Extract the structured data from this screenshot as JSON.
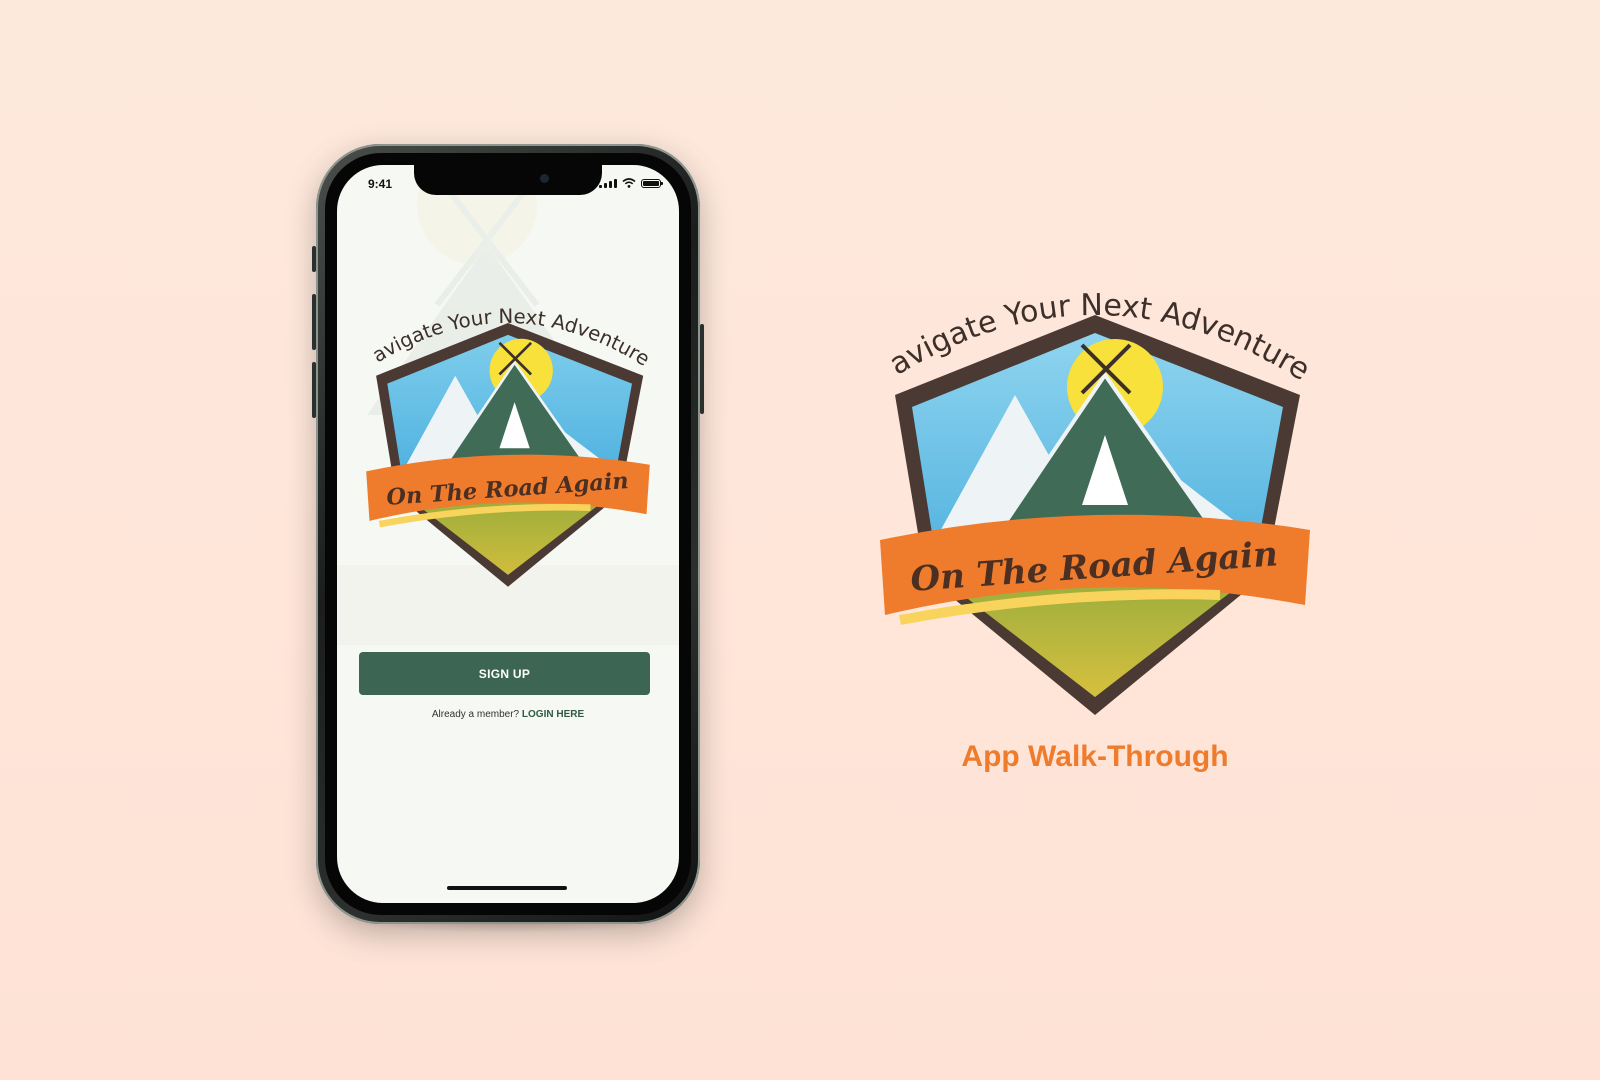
{
  "status_bar": {
    "time": "9:41"
  },
  "logo": {
    "tagline": "Navigate Your Next Adventure!",
    "brand": "On The Road Again"
  },
  "signup": {
    "button_label": "SIGN UP"
  },
  "login": {
    "prompt": "Already a member?",
    "link_label": "LOGIN HERE"
  },
  "caption": {
    "text": "App Walk-Through"
  },
  "colors": {
    "accent_green": "#3c6553",
    "banner_orange": "#ef7b2c",
    "sun_yellow": "#f7e13a",
    "sky_blue": "#4fb3df",
    "frame_brown": "#4a3a33"
  }
}
